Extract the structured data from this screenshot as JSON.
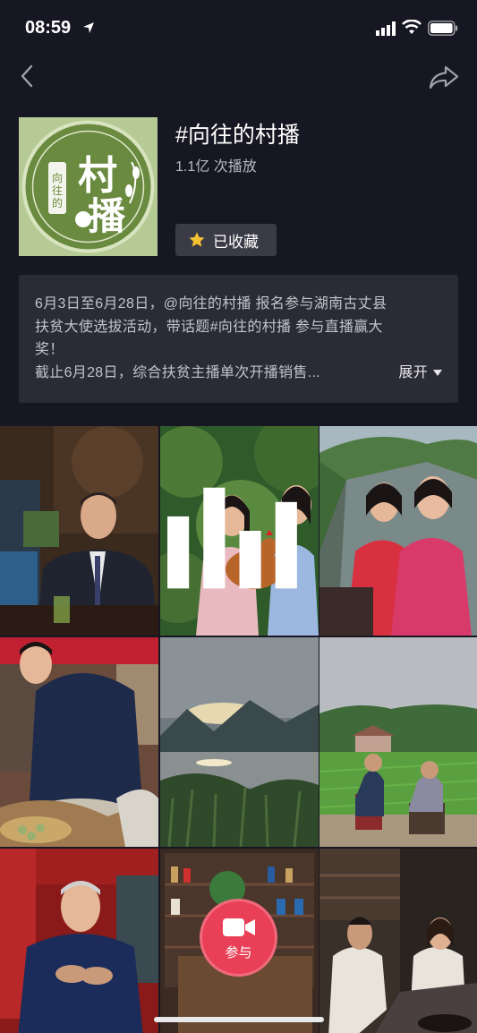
{
  "status_bar": {
    "time": "08:59"
  },
  "header": {
    "title": "#向往的村播",
    "plays": "1.1亿 次播放",
    "favorite_label": "已收藏",
    "cover_text": "向往的村播"
  },
  "description": {
    "line1": "6月3日至6月28日，@向往的村播 报名参与湖南古丈县",
    "line2": "扶贫大使选拔活动，带话题#向往的村播 参与直播赢大",
    "line3": "奖！",
    "line4": "截止6月28日，综合扶贫主播单次开播销售...",
    "expand_label": "展开"
  },
  "join_button": {
    "label": "参与"
  },
  "colors": {
    "background": "#161722",
    "accent": "#e94057",
    "panel": "#2a2b35"
  }
}
